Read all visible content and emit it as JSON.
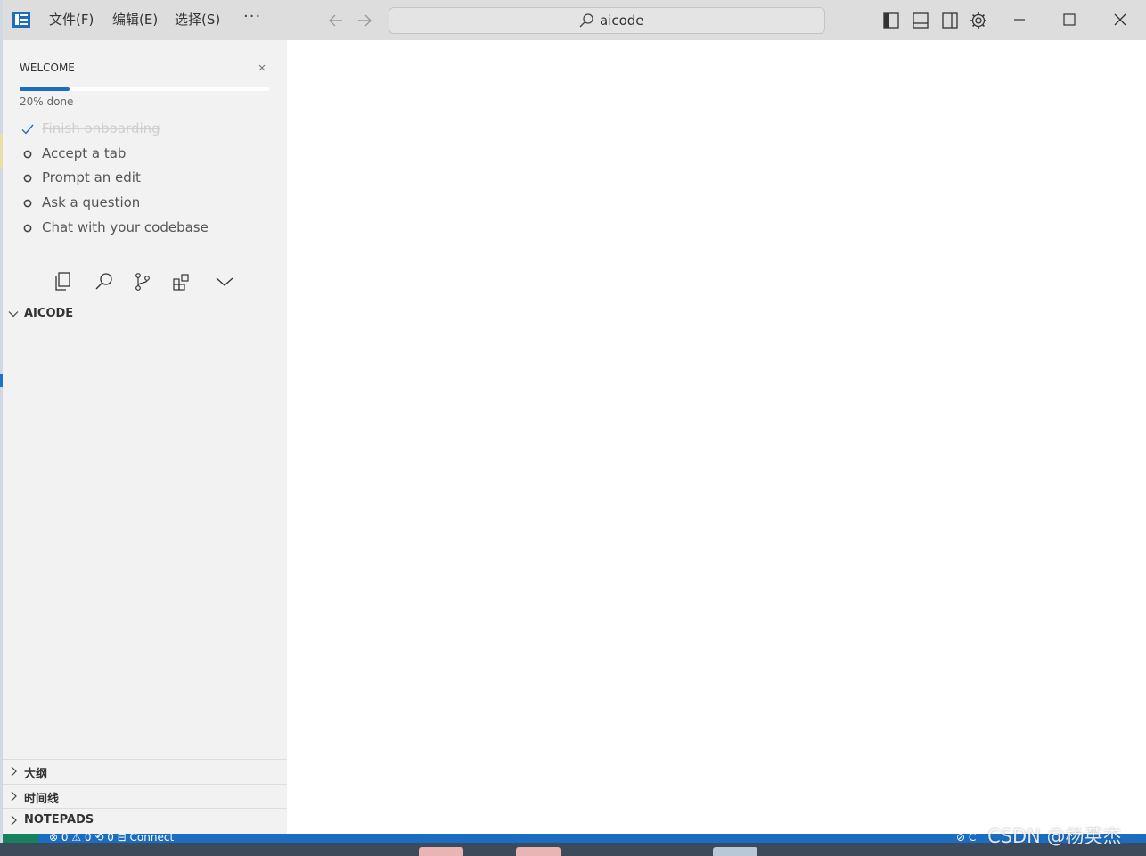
{
  "window": {
    "search_text": "aicode",
    "menus": [
      "文件(F)",
      "编辑(E)",
      "选择(S)"
    ],
    "more_label": "···"
  },
  "welcome": {
    "title": "WELCOME",
    "progress": 0.2,
    "progress_text": "20% done",
    "tasks": [
      {
        "label": "Finish onboarding",
        "done": true
      },
      {
        "label": "Accept a tab",
        "done": false
      },
      {
        "label": "Prompt an edit",
        "done": false
      },
      {
        "label": "Ask a question",
        "done": false
      },
      {
        "label": "Chat with your codebase",
        "done": false
      }
    ]
  },
  "activity_icons": [
    "files-icon",
    "search-icon",
    "source-control-icon",
    "extensions-icon",
    "chevron-down-icon"
  ],
  "explorer": {
    "folder": "AICODE"
  },
  "bottom_sections": [
    "大纲",
    "时间线",
    "NOTEPADS"
  ],
  "status": {
    "left": "⊗ 0 ⚠ 0   ⟲ 0   ⊟ Connect",
    "right": "⊘ C"
  },
  "watermark": "CSDN @杨英杰",
  "colors": {
    "accent": "#1b6dc1",
    "remote": "#16825d",
    "sidebar_bg": "#f2f2f2",
    "titlebar_bg": "#dddddd"
  }
}
